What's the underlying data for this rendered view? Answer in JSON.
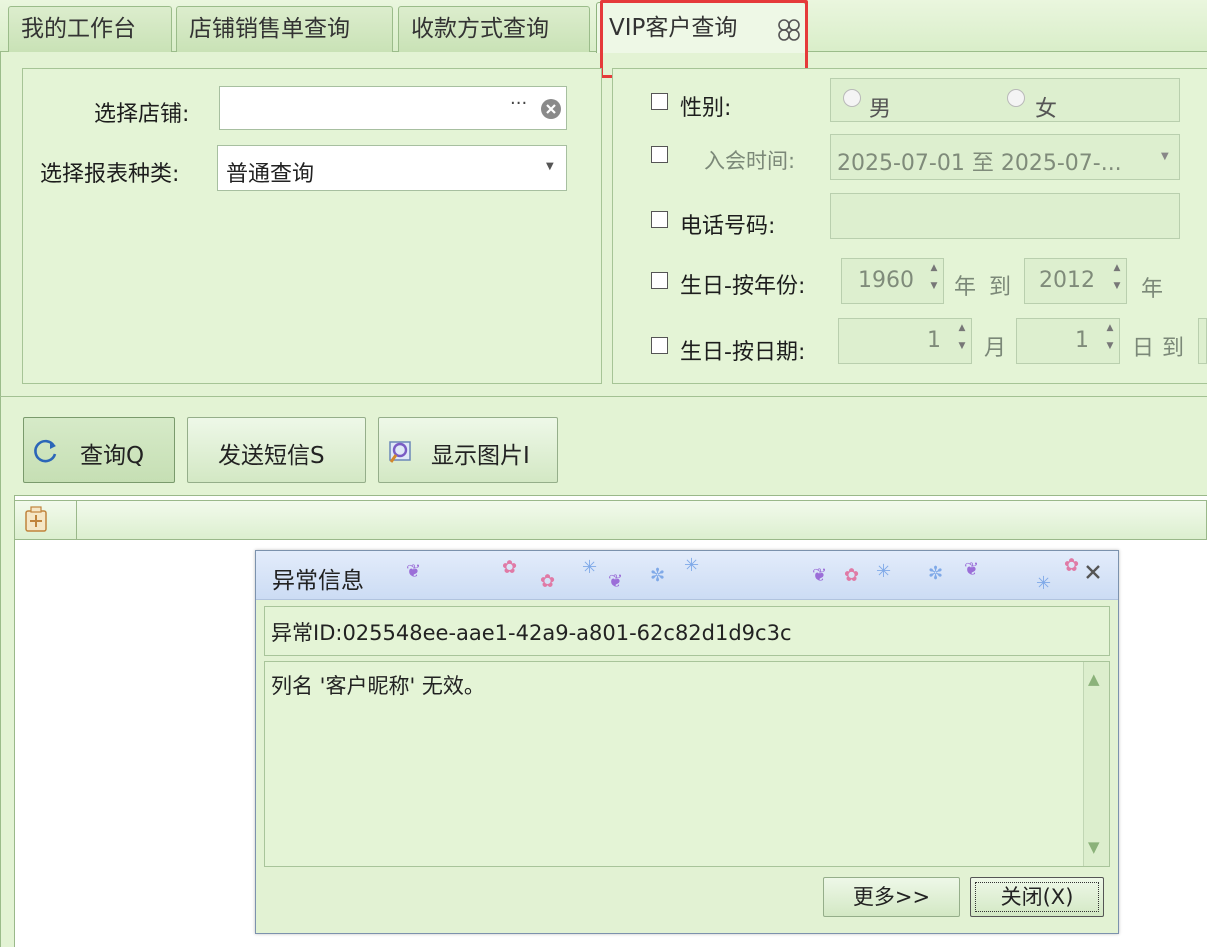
{
  "tabs": [
    {
      "label": "我的工作台"
    },
    {
      "label": "店铺销售单查询"
    },
    {
      "label": "收款方式查询"
    },
    {
      "label": "VIP客户查询"
    }
  ],
  "filters": {
    "store_label": "选择店铺:",
    "store_value": "",
    "store_browse": "···",
    "report_label": "选择报表种类:",
    "report_value": "普通查询",
    "gender_label": "性别:",
    "gender_male": "男",
    "gender_female": "女",
    "join_label": "入会时间:",
    "join_value": "2025-07-01 至 2025-07-...",
    "phone_label": "电话号码:",
    "phone_value": "",
    "birth_year_label": "生日-按年份:",
    "birth_year_from": "1960",
    "birth_year_unit1": "年",
    "birth_year_to_text": "到",
    "birth_year_to": "2012",
    "birth_year_unit2": "年",
    "birth_date_label": "生日-按日期:",
    "birth_month": "1",
    "month_unit": "月",
    "birth_day": "1",
    "day_unit": "日",
    "birth_date_to_text": "到"
  },
  "toolbar": {
    "query_label": "查询Q",
    "sms_label": "发送短信S",
    "image_label": "显示图片I"
  },
  "dialog": {
    "title": "异常信息",
    "error_id": "异常ID:025548ee-aae1-42a9-a801-62c82d1d9c3c",
    "message": "列名 '客户昵称' 无效。",
    "more_label": "更多>>",
    "close_label": "关闭(X)"
  },
  "colors": {
    "highlight": "#e53a3a",
    "theme_green": "#e3f3d4",
    "dialog_title": "#d3e1f6"
  }
}
